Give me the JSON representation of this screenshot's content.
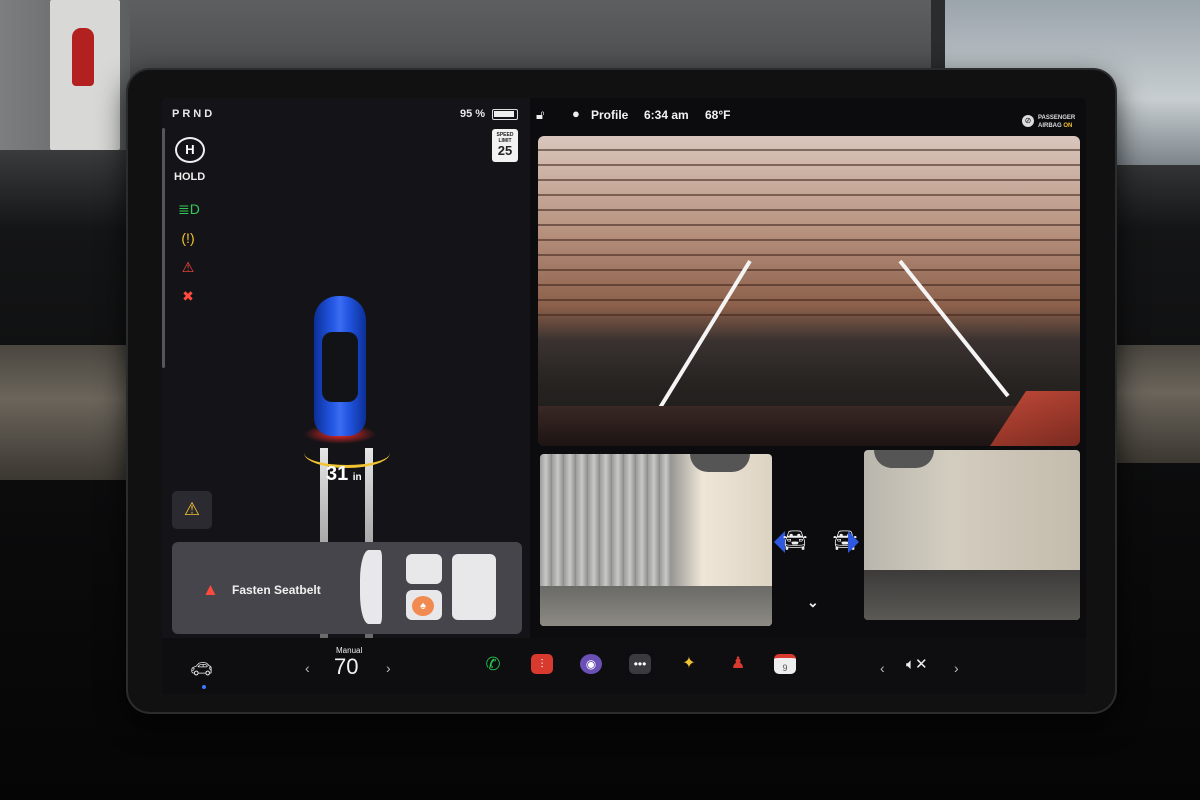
{
  "status": {
    "gear": "PRND",
    "battery": "95 %",
    "profile": "Profile",
    "time": "6:34 am",
    "temperature": "68°F",
    "airbag_line1": "PASSENGER",
    "airbag_line2": "AIRBAG",
    "airbag_state": "ON"
  },
  "speed_limit": {
    "caption": "SPEED LIMIT",
    "value": "25"
  },
  "hold": {
    "icon_text": "H",
    "label": "HOLD"
  },
  "parking": {
    "distance": "31",
    "unit": "in"
  },
  "alert": {
    "message": "Fasten Seatbelt"
  },
  "climate": {
    "mode": "Manual",
    "value": "70"
  },
  "calendar": {
    "day": "9"
  },
  "colors": {
    "accent_blue": "#2e58e0",
    "warning_yellow": "#f1c232",
    "alert_red": "#ff4a3d"
  },
  "icons": [
    "parking-lights-icon",
    "tire-pressure-icon",
    "seatbelt-warning-icon",
    "airbag-warning-icon",
    "lock-icon",
    "profile-icon",
    "phone-icon",
    "voice-recorder-icon",
    "camera-app-icon",
    "more-apps-icon",
    "games-icon",
    "joystick-icon",
    "calendar-icon",
    "volume-mute-icon"
  ]
}
